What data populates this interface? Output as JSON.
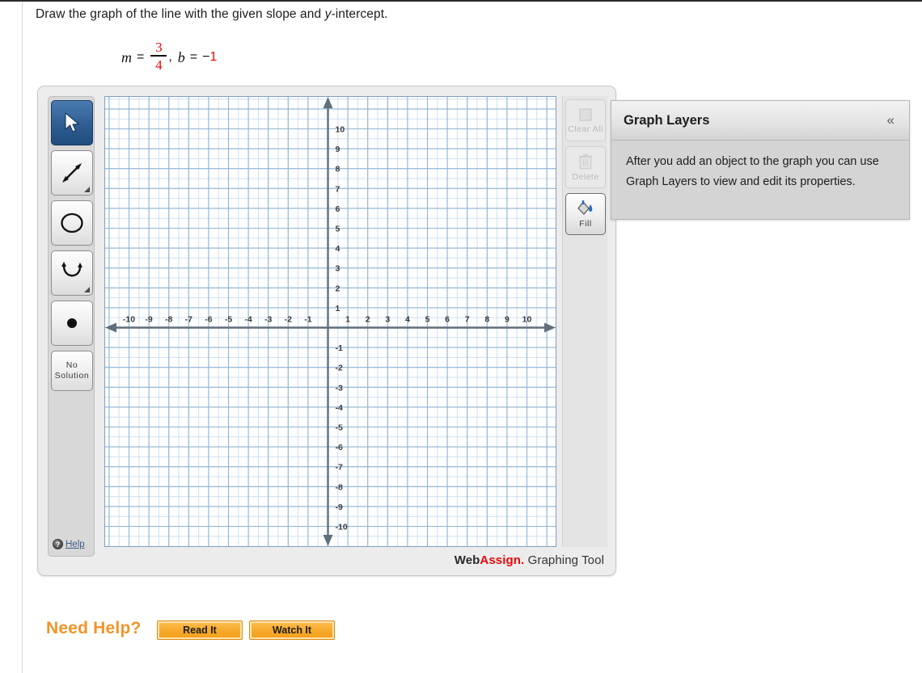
{
  "question": {
    "text_before": "Draw the graph of the line with the given slope and ",
    "italic_var": "y",
    "text_after": "-intercept."
  },
  "equation": {
    "m_symbol": "m",
    "equals": "=",
    "numerator": "3",
    "denominator": "4",
    "comma": ",",
    "b_symbol": "b",
    "equals2": "=",
    "minus": "−",
    "b_value": "1"
  },
  "toolbar": {
    "tools": [
      {
        "name": "select-tool",
        "icon": "cursor-arrow-icon",
        "selected": true,
        "has_submenu": false
      },
      {
        "name": "line-tool",
        "icon": "double-arrow-line-icon",
        "selected": false,
        "has_submenu": true
      },
      {
        "name": "circle-tool",
        "icon": "circle-icon",
        "selected": false,
        "has_submenu": false
      },
      {
        "name": "parabola-tool",
        "icon": "curve-icon",
        "selected": false,
        "has_submenu": true
      },
      {
        "name": "point-tool",
        "icon": "dot-icon",
        "selected": false,
        "has_submenu": false
      }
    ],
    "no_solution_line1": "No",
    "no_solution_line2": "Solution",
    "help_label": "Help",
    "help_icon": "question-mark-icon"
  },
  "right_toolbar": {
    "clear_all_label": "Clear All",
    "clear_all_enabled": false,
    "delete_label": "Delete",
    "delete_enabled": false,
    "fill_label": "Fill",
    "fill_enabled": true
  },
  "branding": {
    "web": "Web",
    "assign": "Assign.",
    "tool": "Graphing Tool"
  },
  "graph_layers": {
    "title": "Graph Layers",
    "collapse_icon": "«",
    "body": "After you add an object to the graph you can use Graph Layers to view and edit its properties."
  },
  "need_help": {
    "label": "Need Help?",
    "read_it": "Read It",
    "watch_it": "Watch It"
  },
  "chart_data": {
    "type": "scatter",
    "title": "",
    "xlabel": "",
    "ylabel": "",
    "xlim": [
      -11.5,
      11.5
    ],
    "ylim": [
      -11.5,
      11.5
    ],
    "grid": true,
    "x_ticks": [
      -10,
      -9,
      -8,
      -7,
      -6,
      -5,
      -4,
      -3,
      -2,
      -1,
      1,
      2,
      3,
      4,
      5,
      6,
      7,
      8,
      9,
      10
    ],
    "y_ticks": [
      10,
      9,
      8,
      7,
      6,
      5,
      4,
      3,
      2,
      1,
      -1,
      -2,
      -3,
      -4,
      -5,
      -6,
      -7,
      -8,
      -9,
      -10
    ],
    "grid_minor_color": "#cfe0ef",
    "grid_major_color": "#8fb5d4",
    "axis_color": "#5f6f7c",
    "series": [],
    "annotations": []
  }
}
